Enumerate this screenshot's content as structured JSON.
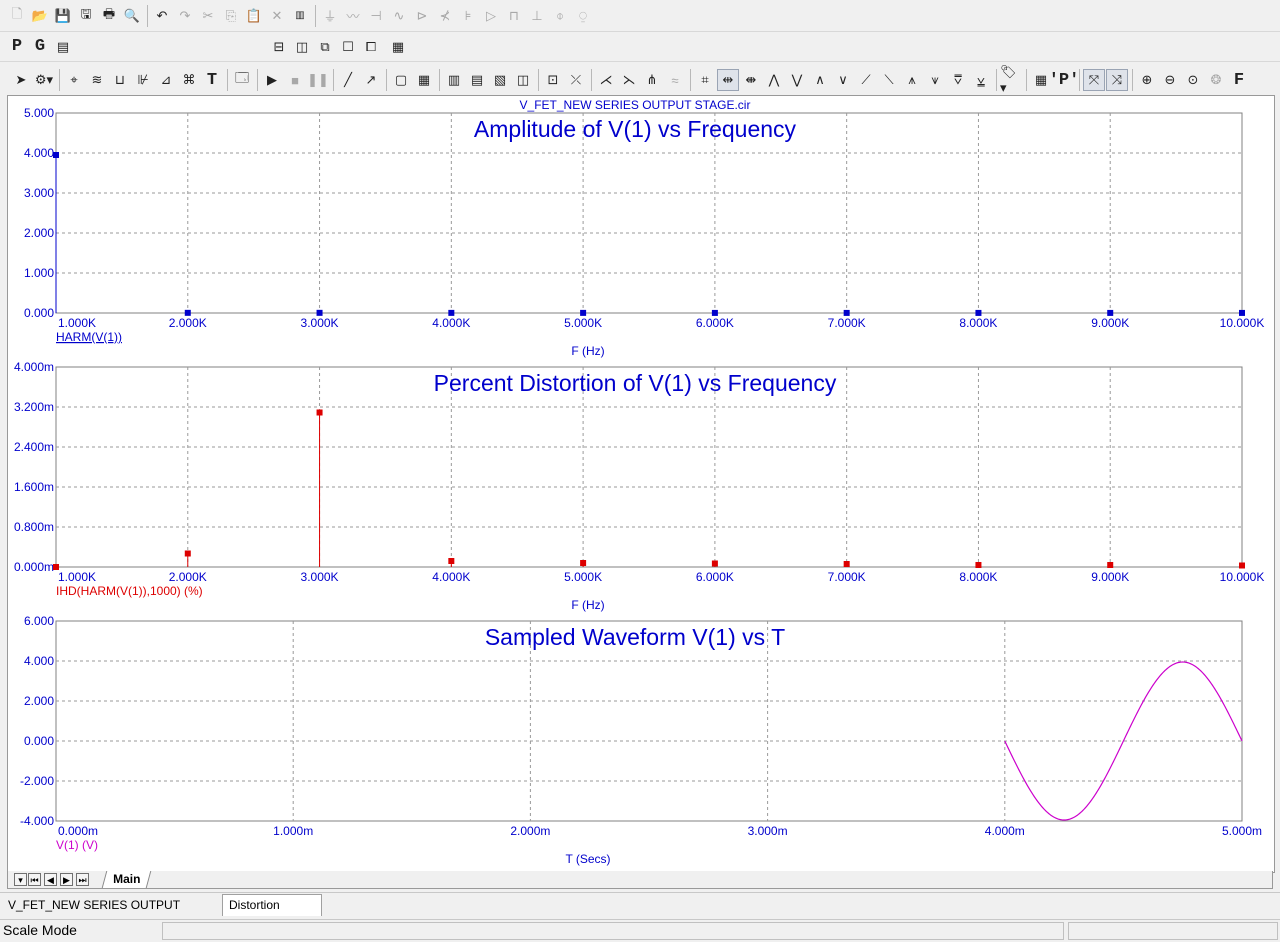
{
  "toolbar": {
    "row2_letters": [
      "P",
      "G"
    ]
  },
  "plot": {
    "file_title": "V_FET_NEW SERIES OUTPUT STAGE.cir"
  },
  "chart_data": [
    {
      "type": "bar",
      "title": "Amplitude of V(1) vs Frequency",
      "xlabel": "F (Hz)",
      "ylabel": "",
      "legend": "HARM(V(1))",
      "color": "#0000cc",
      "xlim": [
        1000,
        10000
      ],
      "ylim": [
        0,
        5
      ],
      "x_ticks": [
        "1.000K",
        "2.000K",
        "3.000K",
        "4.000K",
        "5.000K",
        "6.000K",
        "7.000K",
        "8.000K",
        "9.000K",
        "10.000K"
      ],
      "y_ticks": [
        "0.000",
        "1.000",
        "2.000",
        "3.000",
        "4.000",
        "5.000"
      ],
      "x": [
        1000,
        2000,
        3000,
        4000,
        5000,
        6000,
        7000,
        8000,
        9000,
        10000
      ],
      "values": [
        3.95,
        0.004,
        0.004,
        0.003,
        0.003,
        0.002,
        0.002,
        0.002,
        0.002,
        0.002
      ]
    },
    {
      "type": "bar",
      "title": "Percent Distortion of V(1) vs Frequency",
      "xlabel": "F (Hz)",
      "ylabel": "",
      "legend": "IHD(HARM(V(1)),1000) (%)",
      "color": "#dd0000",
      "xlim": [
        1000,
        10000
      ],
      "ylim": [
        0,
        4
      ],
      "y_unit": "m",
      "x_ticks": [
        "1.000K",
        "2.000K",
        "3.000K",
        "4.000K",
        "5.000K",
        "6.000K",
        "7.000K",
        "8.000K",
        "9.000K",
        "10.000K"
      ],
      "y_ticks": [
        "0.000m",
        "0.800m",
        "1.600m",
        "2.400m",
        "3.200m",
        "4.000m"
      ],
      "x": [
        1000,
        2000,
        3000,
        4000,
        5000,
        6000,
        7000,
        8000,
        9000,
        10000
      ],
      "values": [
        0.0,
        0.27,
        3.09,
        0.12,
        0.08,
        0.07,
        0.06,
        0.04,
        0.04,
        0.03
      ]
    },
    {
      "type": "line",
      "title": "Sampled Waveform  V(1) vs T",
      "xlabel": "T (Secs)",
      "ylabel": "",
      "legend": "V(1) (V)",
      "color": "#cc00cc",
      "xlim": [
        0,
        5
      ],
      "x_unit": "m",
      "ylim": [
        -4,
        6
      ],
      "x_ticks": [
        "0.000m",
        "1.000m",
        "2.000m",
        "3.000m",
        "4.000m",
        "5.000m"
      ],
      "y_ticks": [
        "-4.000",
        "-2.000",
        "0.000",
        "2.000",
        "4.000",
        "6.000"
      ],
      "wave": {
        "t_start": 4.0,
        "t_end": 5.0,
        "amplitude": 3.95,
        "frequency_khz": 1,
        "phase": "negative-sine"
      }
    }
  ],
  "sheet": {
    "active_tab": "Main"
  },
  "doc_tabs": [
    {
      "label": "V_FET_NEW SERIES OUTPUT STAGE.cir"
    },
    {
      "label": "Distortion Analysis"
    }
  ],
  "status": {
    "mode": "Scale Mode"
  }
}
